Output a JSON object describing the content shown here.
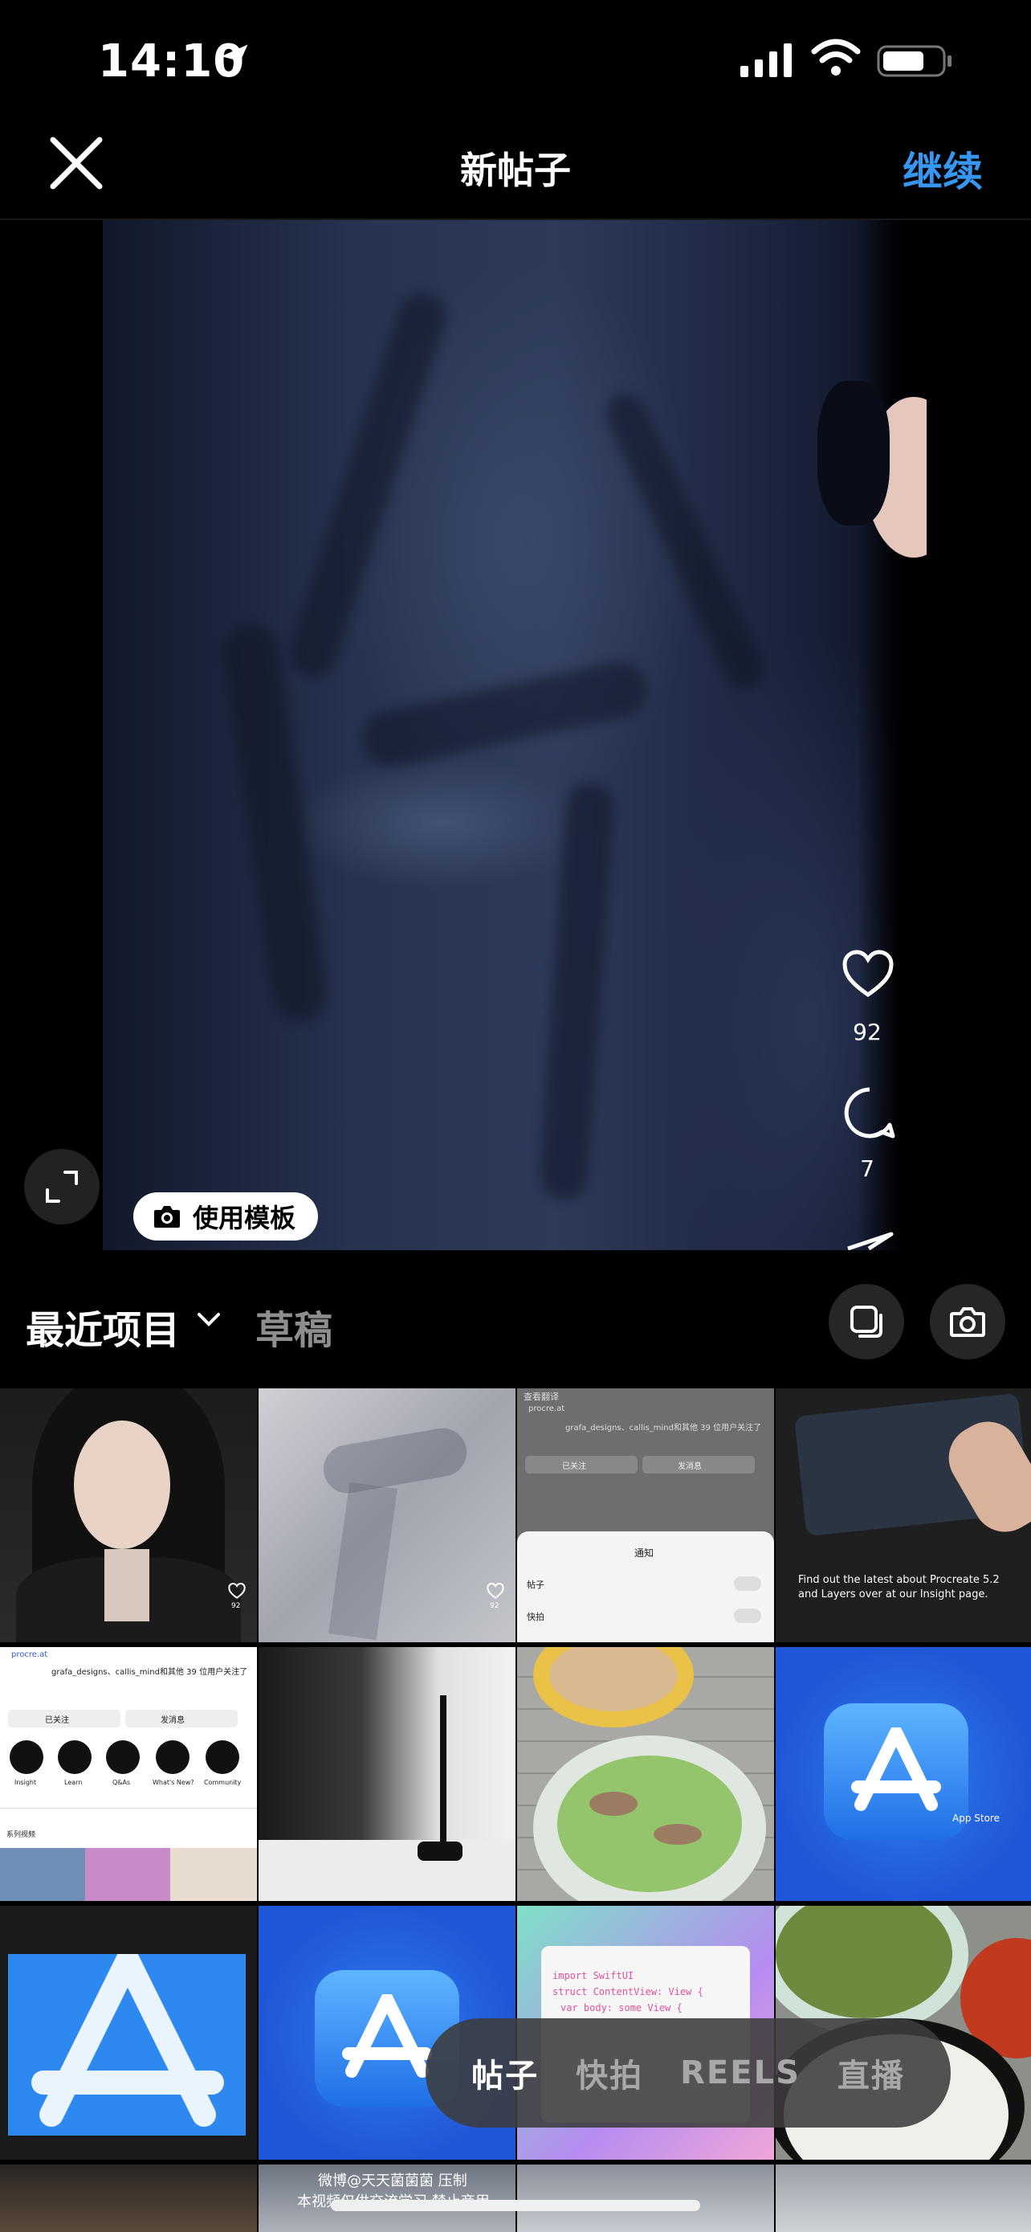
{
  "status_bar": {
    "time": "14:10"
  },
  "nav": {
    "title": "新帖子",
    "continue_label": "继续"
  },
  "preview": {
    "template_label": "使用模板",
    "like_count": "92",
    "comment_count": "7"
  },
  "gallery": {
    "album_label": "最近项目",
    "drafts_label": "草稿",
    "thumbnails": {
      "t3": {
        "header": "查看翻译",
        "site": "procre.at",
        "followers": "grafa_designs、callis_mind和其他 39 位用户关注了",
        "btn_following": "已关注",
        "btn_message": "发消息",
        "sheet_title": "通知",
        "row1": "帖子",
        "row2": "快拍"
      },
      "t4": {
        "caption": "Find out the latest about Procreate 5.2 and Layers over at our Insight page."
      },
      "t5": {
        "site": "procre.at",
        "followers": "grafa_designs、callis_mind和其他 39 位用户关注了",
        "btn_following": "已关注",
        "btn_message": "发消息",
        "hl1": "Insight",
        "hl2": "Learn",
        "hl3": "Q&As",
        "hl4": "What's New?",
        "hl5": "Community",
        "series": "系列视频"
      },
      "t8": {
        "label": "App Store"
      },
      "t11": {
        "code1": "import SwiftUI",
        "code2": "struct ContentView: View {",
        "code3": "var body: some View {"
      },
      "t13": {
        "watermark1": "微博@天天菌菌菌 压制",
        "watermark2": "本视频仅供交流学习 禁止商用"
      },
      "like_small": "92"
    }
  },
  "modes": {
    "post": "帖子",
    "story": "快拍",
    "reels": "REELS",
    "live": "直播"
  }
}
